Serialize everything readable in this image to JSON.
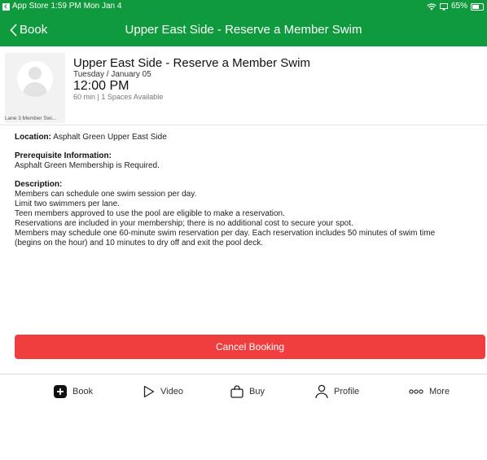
{
  "statusbar": {
    "app": "App Store",
    "time": "1:59 PM",
    "date": "Mon Jan 4",
    "battery": "65%",
    "battery_level": 0.65
  },
  "nav": {
    "back_label": "Book",
    "title": "Upper East Side - Reserve a Member Swim"
  },
  "session": {
    "thumb_caption": "Lane 3 Member Swi...",
    "title": "Upper East Side - Reserve a Member Swim",
    "date": "Tuesday / January 05",
    "time": "12:00 PM",
    "meta": "60 min | 1 Spaces Available"
  },
  "details": {
    "location_label": "Location:",
    "location_value": "Asphalt Green Upper East Side",
    "prereq_label": "Prerequisite Information:",
    "prereq_value": "Asphalt Green Membership is Required.",
    "desc_label": "Description:",
    "desc_lines": [
      "Members can schedule one swim session per day.",
      "Limit two swimmers per lane.",
      "Teen members approved to use the pool are eligible to make a reservation.",
      "Reservations are included in your membership; there is no additional cost to secure your spot.",
      "Members may schedule one 60-minute swim reservation per day. Each reservation includes 50 minutes of swim time",
      "(begins on the hour) and 10 minutes to dry off and exit the pool deck."
    ]
  },
  "cancel_button": "Cancel Booking",
  "colors": {
    "brand_green": "#0e9a3d",
    "cancel_red": "#f03d3d"
  },
  "tabs": [
    {
      "label": "Book",
      "icon": "plus-square-icon"
    },
    {
      "label": "Video",
      "icon": "play-triangle-icon"
    },
    {
      "label": "Buy",
      "icon": "shopping-bag-icon"
    },
    {
      "label": "Profile",
      "icon": "person-icon"
    },
    {
      "label": "More",
      "icon": "more-dots-icon"
    }
  ]
}
